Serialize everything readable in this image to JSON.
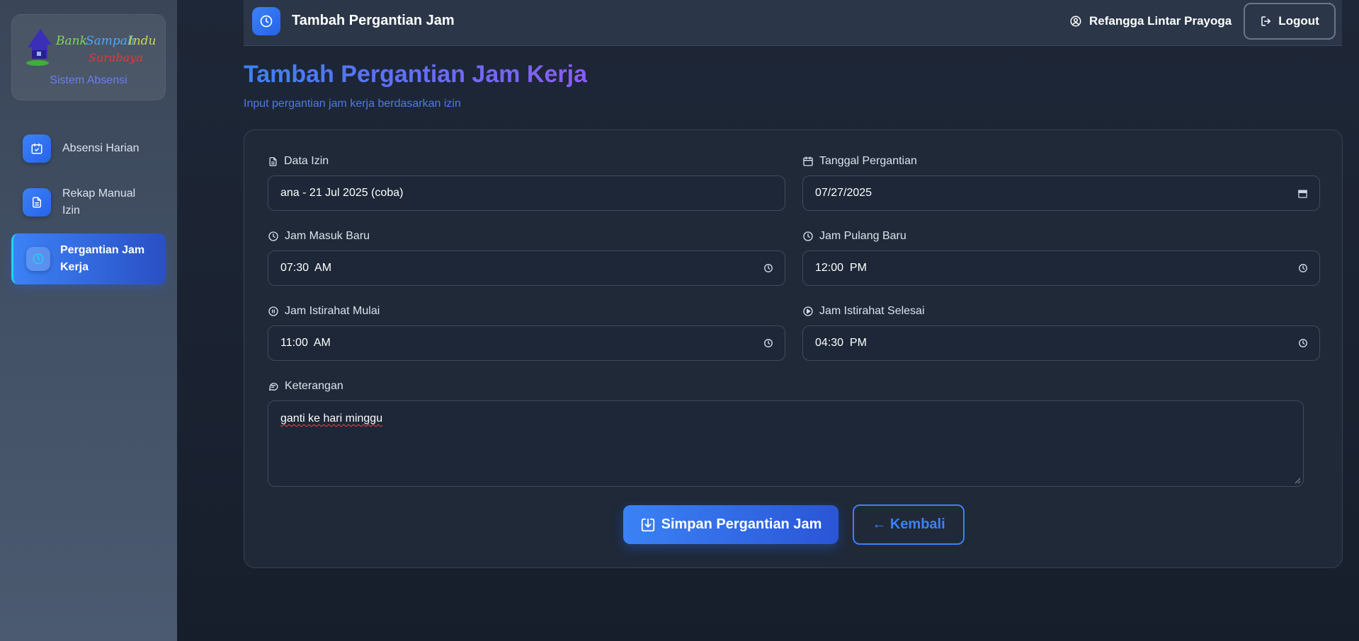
{
  "sidebar": {
    "logo_text": "Bank Sampah Induk Surabaya",
    "subtitle": "Sistem Absensi",
    "items": [
      {
        "label": "Absensi Harian",
        "icon": "calendar-check-icon",
        "active": false
      },
      {
        "label": "Rekap Manual Izin",
        "icon": "document-icon",
        "active": false
      },
      {
        "label": "Pergantian Jam Kerja",
        "icon": "clock-icon",
        "active": true
      }
    ]
  },
  "topbar": {
    "title": "Tambah Pergantian Jam",
    "icon": "clock-icon",
    "user_name": "Refangga Lintar Prayoga",
    "logout_label": "Logout"
  },
  "page": {
    "title": "Tambah Pergantian Jam Kerja",
    "subtitle": "Input pergantian jam kerja berdasarkan izin"
  },
  "form": {
    "data_izin": {
      "label": "Data Izin",
      "value": "ana - 21 Jul 2025 (coba)",
      "icon": "document-icon"
    },
    "tanggal_pergantian": {
      "label": "Tanggal Pergantian",
      "value": "07/27/2025",
      "icon": "calendar-icon"
    },
    "jam_masuk_baru": {
      "label": "Jam Masuk Baru",
      "value": "07:30  AM",
      "icon": "clock-icon"
    },
    "jam_pulang_baru": {
      "label": "Jam Pulang Baru",
      "value": "12:00  PM",
      "icon": "clock-icon"
    },
    "jam_istirahat_mulai": {
      "label": "Jam Istirahat Mulai",
      "value": "11:00  AM",
      "icon": "pause-circle-icon"
    },
    "jam_istirahat_selesai": {
      "label": "Jam Istirahat Selesai",
      "value": "04:30  PM",
      "icon": "play-circle-icon"
    },
    "keterangan": {
      "label": "Keterangan",
      "value": "ganti ke hari minggu",
      "icon": "chat-icon"
    },
    "save_label": "Simpan Pergantian Jam",
    "back_label": "← Kembali"
  },
  "colors": {
    "accent": "#3b82f6",
    "accent_dark": "#2563eb",
    "title_gradient_end": "#8b5cf6",
    "background": "#1e2737",
    "sidebar": "#435166"
  }
}
